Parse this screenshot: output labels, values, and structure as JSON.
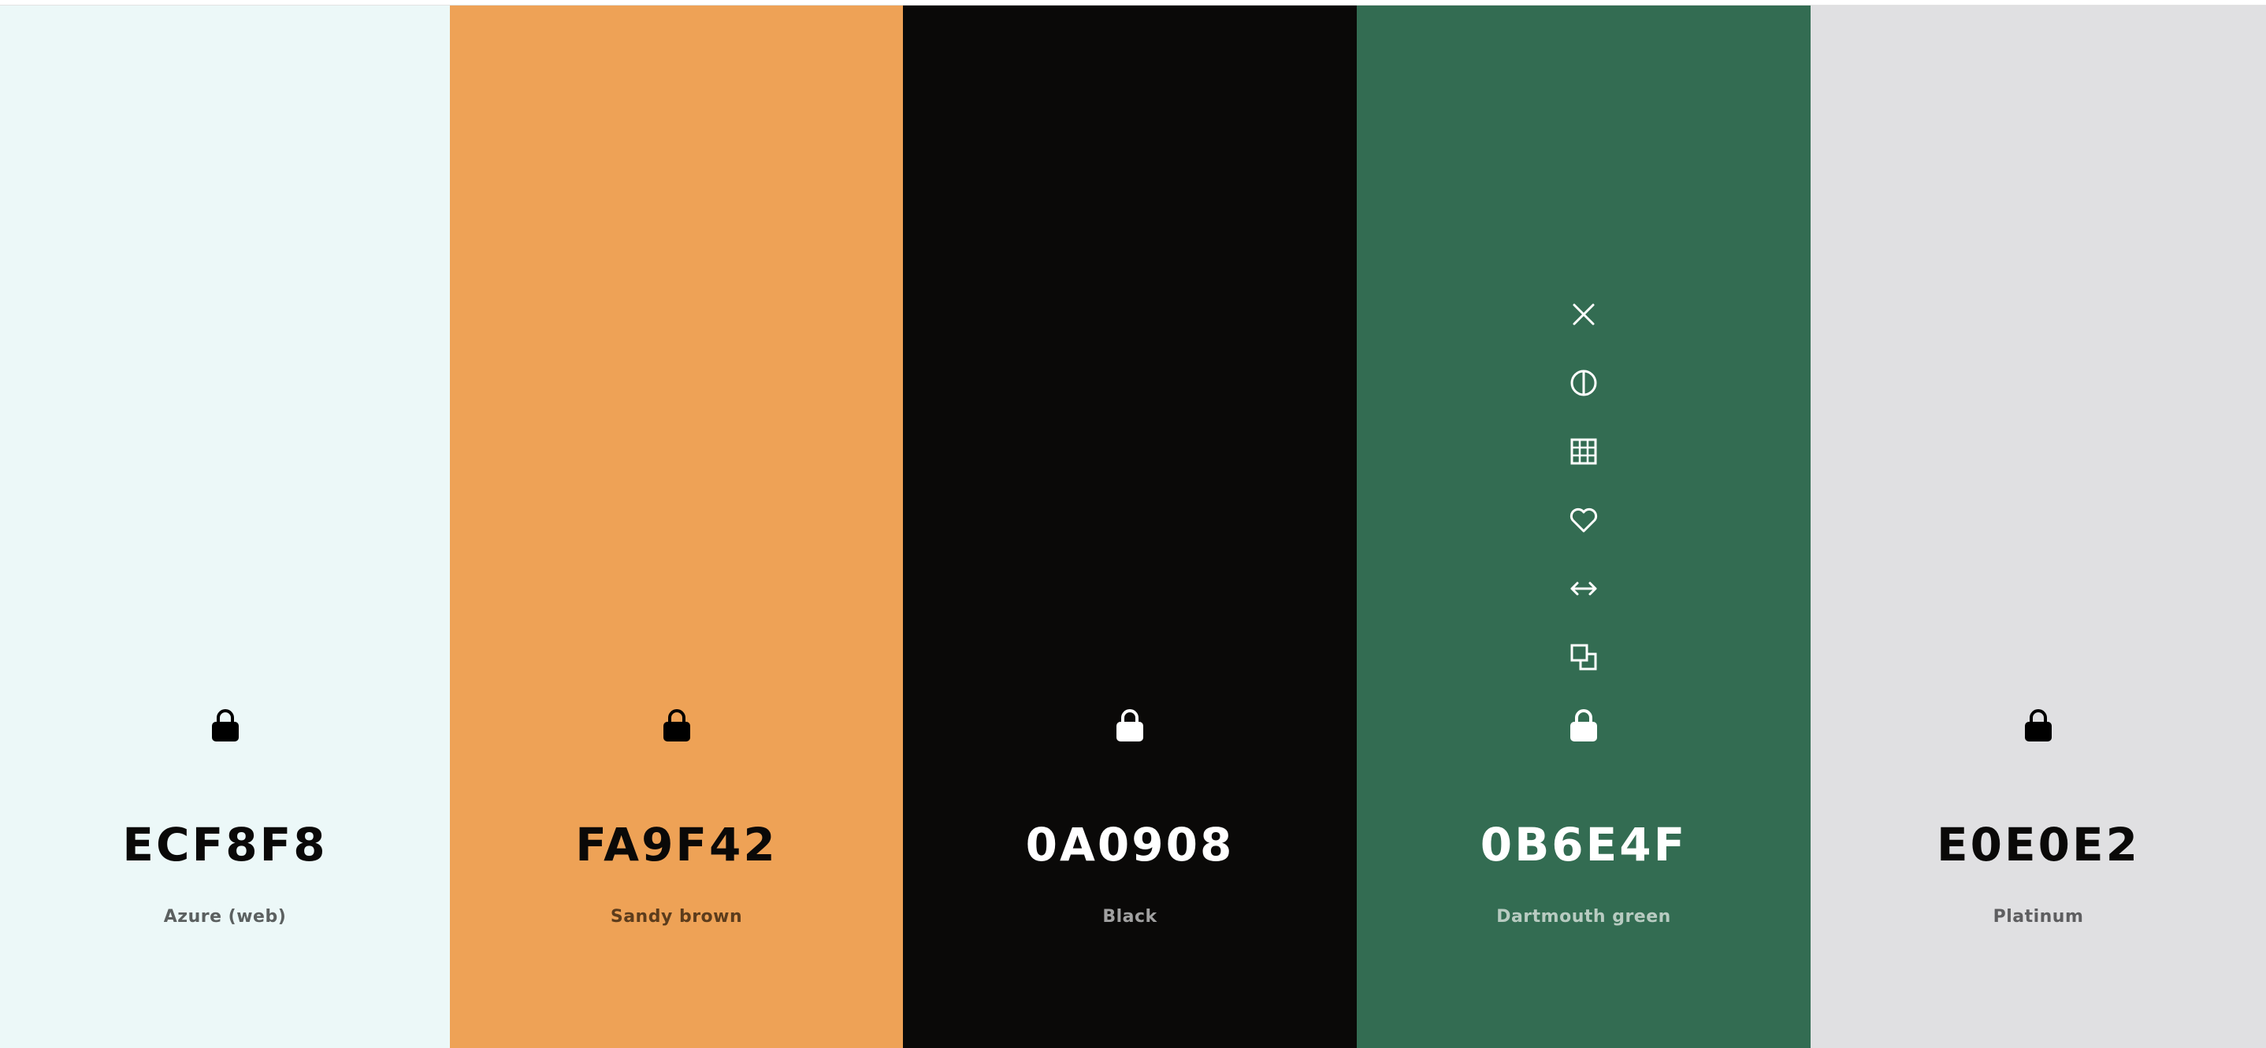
{
  "palette": {
    "colors": [
      {
        "hex": "ECF8F8",
        "name": "Azure (web)",
        "background": "#ECF8F8",
        "text_color": "#0a0908",
        "name_color": "#5b6060",
        "icon_color": "#000000"
      },
      {
        "hex": "FA9F42",
        "name": "Sandy brown",
        "background": "#EEA256",
        "text_color": "#0a0908",
        "name_color": "#5c3c1c",
        "icon_color": "#000000"
      },
      {
        "hex": "0A0908",
        "name": "Black",
        "background": "#0A0908",
        "text_color": "#ffffff",
        "name_color": "#a0a0a0",
        "icon_color": "#ffffff"
      },
      {
        "hex": "0B6E4F",
        "name": "Dartmouth green",
        "background": "#336C52",
        "text_color": "#ffffff",
        "name_color": "#b8cbc1",
        "icon_color": "#ffffff"
      },
      {
        "hex": "E0E0E2",
        "name": "Platinum",
        "background": "#E0E0E2",
        "text_color": "#0a0908",
        "name_color": "#5e5e60",
        "icon_color": "#000000"
      }
    ],
    "hover_tools": [
      "close-icon",
      "contrast-icon",
      "grid-icon",
      "heart-icon",
      "arrows-horizontal-icon",
      "copy-icon"
    ],
    "lock_icon": "lock-icon"
  }
}
